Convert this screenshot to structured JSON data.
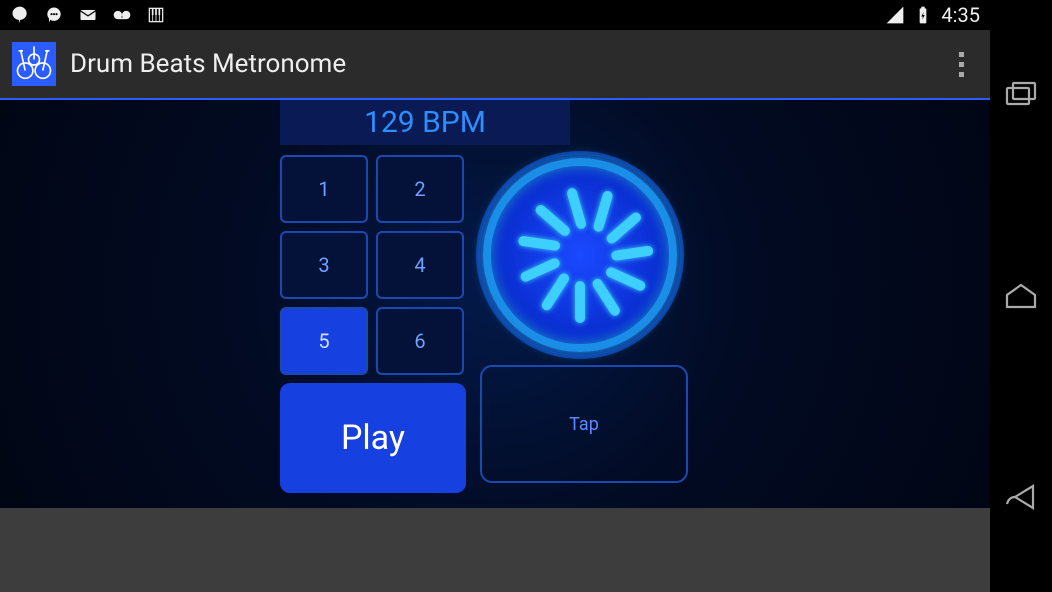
{
  "status": {
    "time": "4:35",
    "icons": [
      "hangouts-icon",
      "chat-icon",
      "mail-icon",
      "voicemail-icon",
      "piano-icon"
    ],
    "right_icons": [
      "signal-icon",
      "battery-charging-icon"
    ]
  },
  "app": {
    "title": "Drum Beats Metronome",
    "bpm_label": "129 BPM",
    "beat_buttons": [
      "1",
      "2",
      "3",
      "4",
      "5",
      "6"
    ],
    "selected_beat_index": 4,
    "play_label": "Play",
    "tap_label": "Tap"
  },
  "nav": {
    "items": [
      "recents-icon",
      "home-icon",
      "back-icon"
    ]
  }
}
